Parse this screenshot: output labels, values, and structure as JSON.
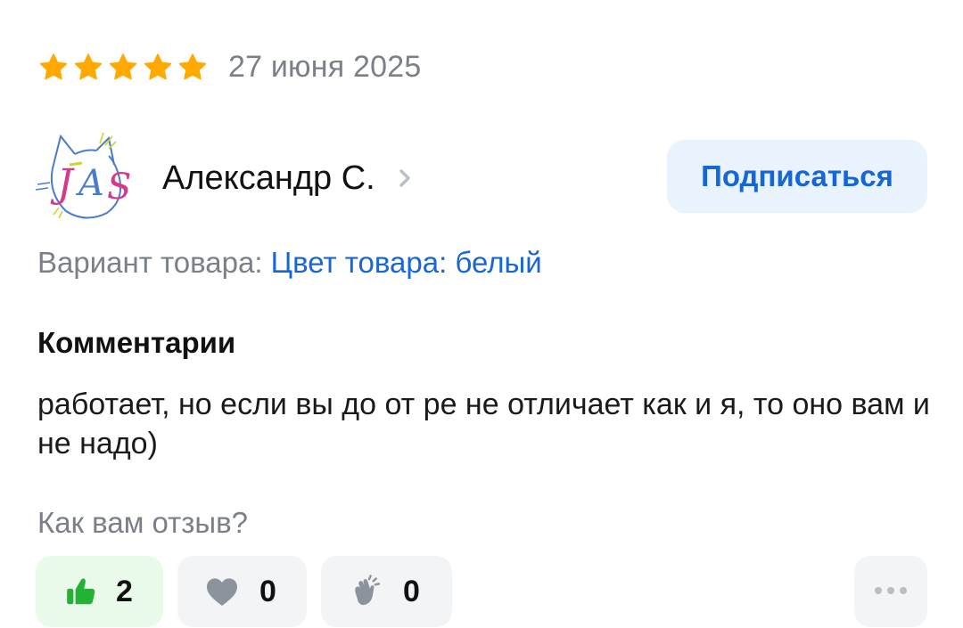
{
  "review": {
    "rating": 5,
    "rating_max": 5,
    "date": "27 июня 2025"
  },
  "author": {
    "name": "Александр С.",
    "avatar_text": "JAS"
  },
  "subscribe_label": "Подписаться",
  "variant": {
    "label": "Вариант товара:",
    "value": "Цвет товара: белый"
  },
  "comments": {
    "heading": "Комментарии",
    "text": "работает, но если вы до от ре не отличает как и я, то оно вам и не надо)"
  },
  "feedback": {
    "question": "Как вам отзыв?",
    "reactions": [
      {
        "icon": "thumbs-up-icon",
        "count": "2"
      },
      {
        "icon": "heart-icon",
        "count": "0"
      },
      {
        "icon": "clapping-hands-icon",
        "count": "0"
      }
    ],
    "more_icon": "more-dots-icon"
  },
  "colors": {
    "star": "#ffa800",
    "accent_blue": "#1766d6",
    "subscribe_bg": "#e9f3fe",
    "like_bg": "#e9faea",
    "like_icon": "#22b335",
    "muted_text": "#7a7f88",
    "chip_bg": "#f3f4f6",
    "icon_gray": "#8d939c"
  }
}
